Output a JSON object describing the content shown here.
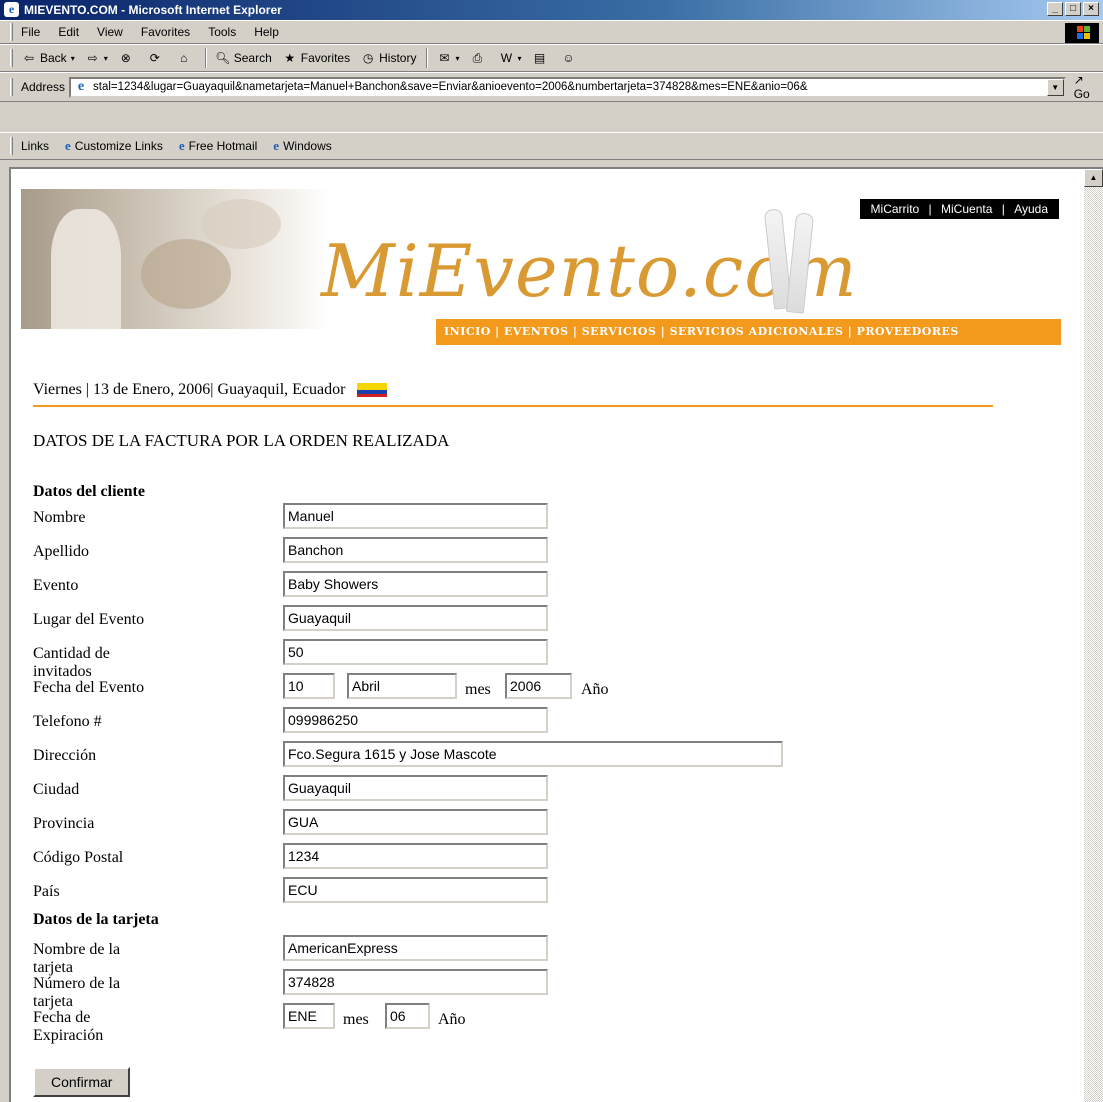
{
  "window": {
    "title": "MIEVENTO.COM - Microsoft Internet Explorer"
  },
  "menubar": {
    "items": [
      "File",
      "Edit",
      "View",
      "Favorites",
      "Tools",
      "Help"
    ]
  },
  "toolbar": {
    "back": "Back",
    "search": "Search",
    "favorites": "Favorites",
    "history": "History"
  },
  "address": {
    "label": "Address",
    "url": "stal=1234&lugar=Guayaquil&nametarjeta=Manuel+Banchon&save=Enviar&anioevento=2006&numbertarjeta=374828&mes=ENE&anio=06&",
    "go": "Go"
  },
  "links": {
    "label": "Links",
    "items": [
      "Customize Links",
      "Free Hotmail",
      "Windows"
    ]
  },
  "banner": {
    "logo": "MiEvento.com",
    "topnav": [
      "MiCarrito",
      "|",
      "MiCuenta",
      "|",
      "Ayuda"
    ],
    "mainnav": "INICIO | EVENTOS | SERVICIOS | SERVICIOS ADICIONALES | PROVEEDORES"
  },
  "dateline": "Viernes | 13 de Enero, 2006| Guayaquil, Ecuador",
  "heading": "DATOS DE LA FACTURA POR LA ORDEN REALIZADA",
  "cliente": {
    "section": "Datos del cliente",
    "nombre": {
      "label": "Nombre",
      "value": "Manuel"
    },
    "apellido": {
      "label": "Apellido",
      "value": "Banchon"
    },
    "evento": {
      "label": "Evento",
      "value": "Baby Showers"
    },
    "lugar": {
      "label": "Lugar del Evento",
      "value": "Guayaquil"
    },
    "cantidad": {
      "label": "Cantidad de invitados",
      "value": "50"
    },
    "fecha": {
      "label": "Fecha del Evento",
      "dia": "10",
      "mes": "Abril",
      "mes_label": "mes",
      "anio": "2006",
      "anio_label": "Año"
    },
    "telefono": {
      "label": "Telefono #",
      "value": "099986250"
    },
    "direccion": {
      "label": "Dirección",
      "value": "Fco.Segura 1615 y Jose Mascote"
    },
    "ciudad": {
      "label": "Ciudad",
      "value": "Guayaquil"
    },
    "provincia": {
      "label": "Provincia",
      "value": "GUA"
    },
    "postal": {
      "label": "Código Postal",
      "value": "1234"
    },
    "pais": {
      "label": "País",
      "value": "ECU"
    }
  },
  "tarjeta": {
    "section": "Datos de la tarjeta",
    "nombre": {
      "label": "Nombre de la tarjeta",
      "value": "AmericanExpress"
    },
    "numero": {
      "label": "Número de la tarjeta",
      "value": "374828"
    },
    "expiracion": {
      "label": "Fecha de Expiración",
      "mes": "ENE",
      "mes_label": "mes",
      "anio": "06",
      "anio_label": "Año"
    }
  },
  "confirm": "Confirmar"
}
